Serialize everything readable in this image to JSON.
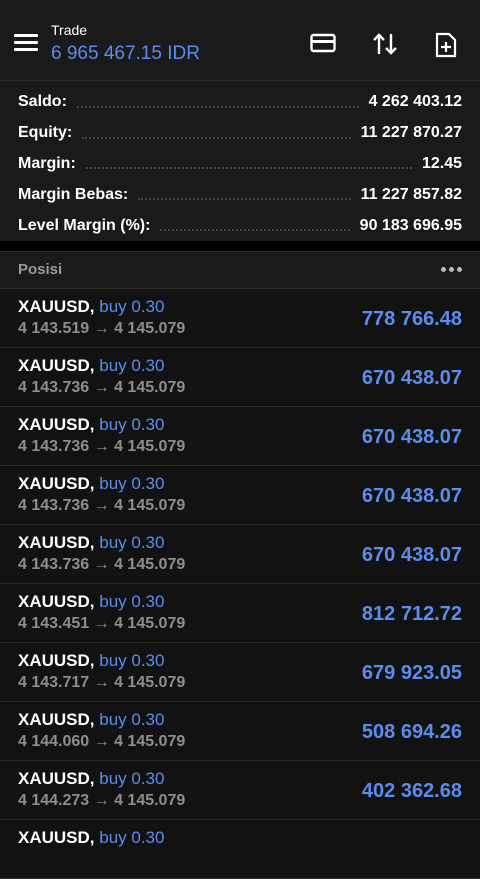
{
  "header": {
    "title": "Trade",
    "balance": "6 965 467.15 IDR"
  },
  "summary": [
    {
      "label": "Saldo:",
      "value": "4 262 403.12"
    },
    {
      "label": "Equity:",
      "value": "11 227 870.27"
    },
    {
      "label": "Margin:",
      "value": "12.45"
    },
    {
      "label": "Margin Bebas:",
      "value": "11 227 857.82"
    },
    {
      "label": "Level Margin (%):",
      "value": "90 183 696.95"
    }
  ],
  "positions_section": {
    "title": "Posisi"
  },
  "positions": [
    {
      "symbol": "XAUUSD,",
      "type": "buy 0.30",
      "prices": "4 143.519 → 4 145.079",
      "profit": "778 766.48"
    },
    {
      "symbol": "XAUUSD,",
      "type": "buy 0.30",
      "prices": "4 143.736 → 4 145.079",
      "profit": "670 438.07"
    },
    {
      "symbol": "XAUUSD,",
      "type": "buy 0.30",
      "prices": "4 143.736 → 4 145.079",
      "profit": "670 438.07"
    },
    {
      "symbol": "XAUUSD,",
      "type": "buy 0.30",
      "prices": "4 143.736 → 4 145.079",
      "profit": "670 438.07"
    },
    {
      "symbol": "XAUUSD,",
      "type": "buy 0.30",
      "prices": "4 143.736 → 4 145.079",
      "profit": "670 438.07"
    },
    {
      "symbol": "XAUUSD,",
      "type": "buy 0.30",
      "prices": "4 143.451 → 4 145.079",
      "profit": "812 712.72"
    },
    {
      "symbol": "XAUUSD,",
      "type": "buy 0.30",
      "prices": "4 143.717 → 4 145.079",
      "profit": "679 923.05"
    },
    {
      "symbol": "XAUUSD,",
      "type": "buy 0.30",
      "prices": "4 144.060 → 4 145.079",
      "profit": "508 694.26"
    },
    {
      "symbol": "XAUUSD,",
      "type": "buy 0.30",
      "prices": "4 144.273 → 4 145.079",
      "profit": "402 362.68"
    },
    {
      "symbol": "XAUUSD,",
      "type": "buy 0.30",
      "prices": "",
      "profit": ""
    }
  ],
  "colors": {
    "accent": "#5b8def",
    "background": "#000000",
    "panel": "#1a1a1a"
  },
  "icons": [
    "menu-icon",
    "wallet-icon",
    "sort-icon",
    "new-document-icon",
    "more-icon"
  ]
}
